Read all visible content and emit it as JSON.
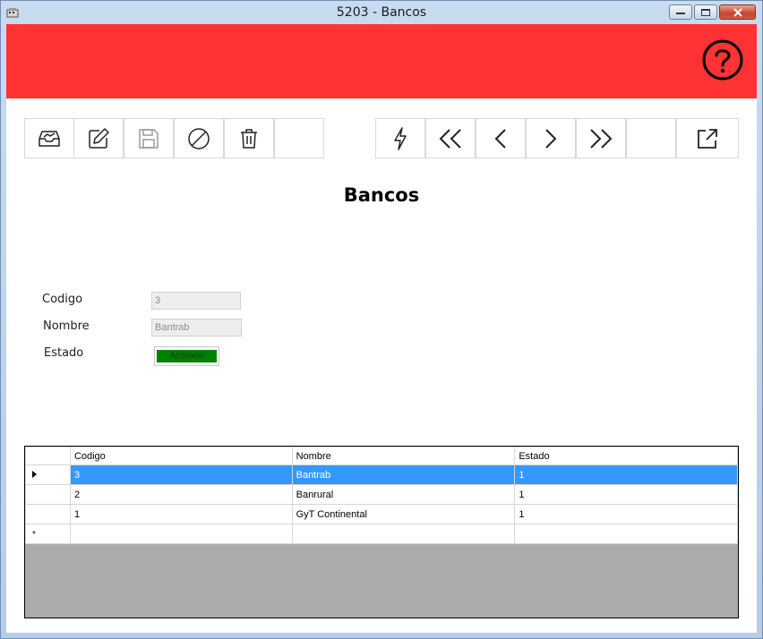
{
  "window": {
    "title": "5203 - Bancos"
  },
  "page": {
    "heading": "Bancos"
  },
  "form": {
    "codigo": {
      "label": "Codigo",
      "value": "3"
    },
    "nombre": {
      "label": "Nombre",
      "value": "Bantrab"
    },
    "estado": {
      "label": "Estado",
      "value": "Activado",
      "color": "#008000"
    }
  },
  "grid": {
    "columns": [
      "Codigo",
      "Nombre",
      "Estado"
    ],
    "rows": [
      {
        "codigo": "3",
        "nombre": "Bantrab",
        "estado": "1"
      },
      {
        "codigo": "2",
        "nombre": "Banrural",
        "estado": "1"
      },
      {
        "codigo": "1",
        "nombre": "GyT Continental",
        "estado": "1"
      }
    ],
    "selected_row": 0,
    "new_row_marker": "*"
  },
  "colors": {
    "header_red": "#ff3333",
    "selection": "#3399ff",
    "grid_empty": "#ababab"
  },
  "toolbar": {
    "left": [
      "inbox-icon",
      "edit-icon",
      "save-icon",
      "cancel-icon",
      "delete-icon",
      "empty"
    ],
    "right": [
      "flash-icon",
      "first-icon",
      "previous-icon",
      "next-icon",
      "last-icon",
      "empty",
      "export-icon"
    ]
  }
}
